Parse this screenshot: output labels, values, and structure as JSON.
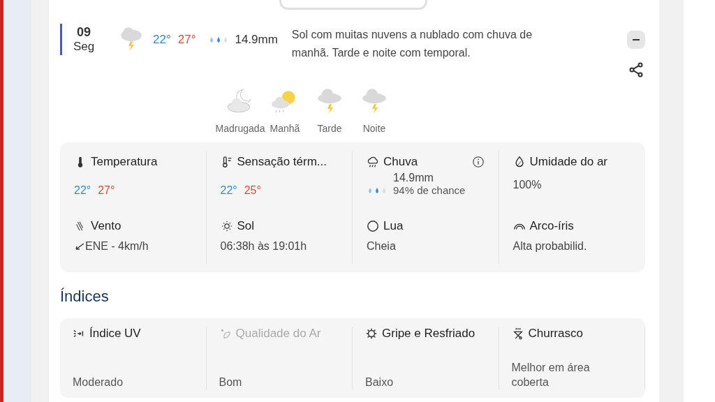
{
  "day": {
    "date": "09",
    "weekday": "Seg",
    "min": "22°",
    "max": "27°",
    "rain": "14.9mm",
    "summary": "Sol com muitas nuvens a nublado com chuva de manhã. Tarde e noite com temporal.",
    "expanded": true
  },
  "periods": [
    {
      "label": "Madrugada"
    },
    {
      "label": "Manhã"
    },
    {
      "label": "Tarde"
    },
    {
      "label": "Noite"
    }
  ],
  "details": [
    {
      "kind": "temps",
      "label": "Temperatura",
      "min": "22°",
      "max": "27°"
    },
    {
      "kind": "temps",
      "label": "Sensação térm...",
      "min": "22°",
      "max": "25°"
    },
    {
      "kind": "rain",
      "label": "Chuva",
      "value": "14.9mm",
      "sub": "94% de chance"
    },
    {
      "kind": "text",
      "label": "Umidade do ar",
      "value": "100%"
    },
    {
      "kind": "wind",
      "label": "Vento",
      "value": "ENE - 4km/h"
    },
    {
      "kind": "text",
      "label": "Sol",
      "value": "06:38h às 19:01h"
    },
    {
      "kind": "text",
      "label": "Lua",
      "value": "Cheia"
    },
    {
      "kind": "text",
      "label": "Arco-íris",
      "value": "Alta probabilid."
    }
  ],
  "indices_title": "Índices",
  "indices": [
    {
      "label": "Índice UV",
      "value": "Moderado"
    },
    {
      "label": "Qualidade do Ar",
      "value": "Bom"
    },
    {
      "label": "Gripe e Resfriado",
      "value": "Baixo"
    },
    {
      "label": "Churrasco",
      "value": "Melhor em área coberta"
    }
  ]
}
